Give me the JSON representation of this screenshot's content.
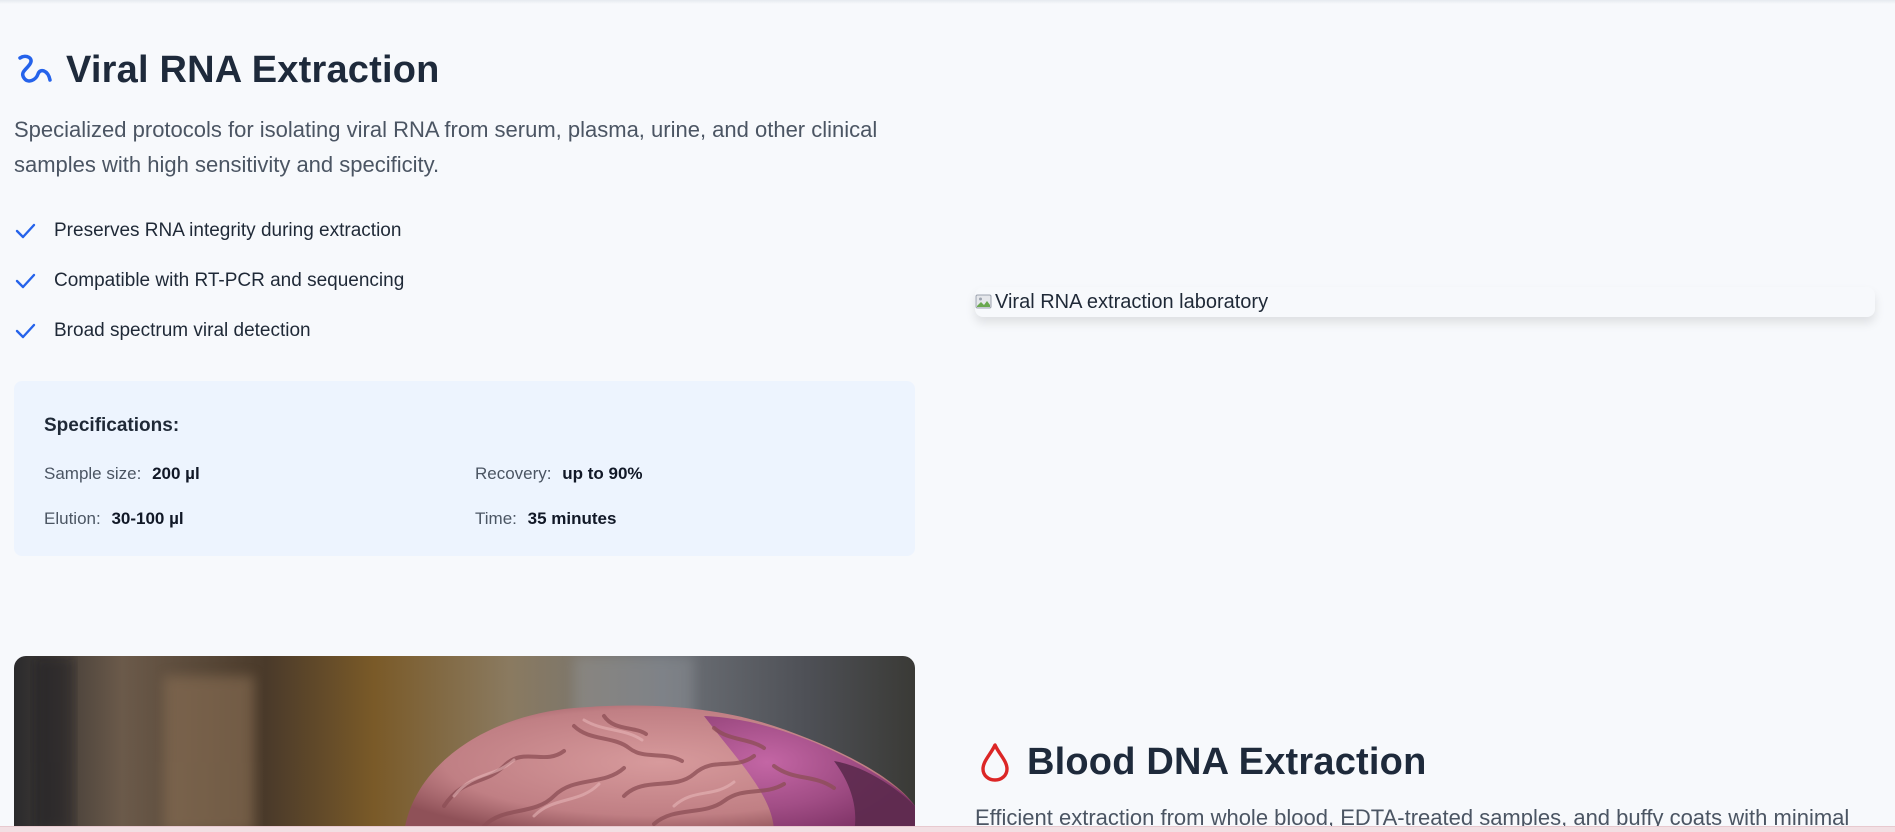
{
  "viral": {
    "title": "Viral RNA Extraction",
    "icon": "wave-icon",
    "description": "Specialized protocols for isolating viral RNA from serum, plasma, urine, and other clinical samples with high sensitivity and specificity.",
    "features": [
      "Preserves RNA integrity during extraction",
      "Compatible with RT-PCR and sequencing",
      "Broad spectrum viral detection"
    ],
    "specs": {
      "title": "Specifications:",
      "sample_label": "Sample size:",
      "sample_value": "200 µl",
      "recovery_label": "Recovery:",
      "recovery_value": "up to 90%",
      "elution_label": "Elution:",
      "elution_value": "30-100 µl",
      "time_label": "Time:",
      "time_value": "35 minutes"
    },
    "image_alt": "Viral RNA extraction laboratory"
  },
  "blood": {
    "title": "Blood DNA Extraction",
    "icon": "droplet-icon",
    "description": "Efficient extraction from whole blood, EDTA-treated samples, and buffy coats with minimal"
  },
  "colors": {
    "accent_blue": "#2563eb",
    "accent_red": "#dc2626",
    "spec_bg": "#edf4fe"
  }
}
